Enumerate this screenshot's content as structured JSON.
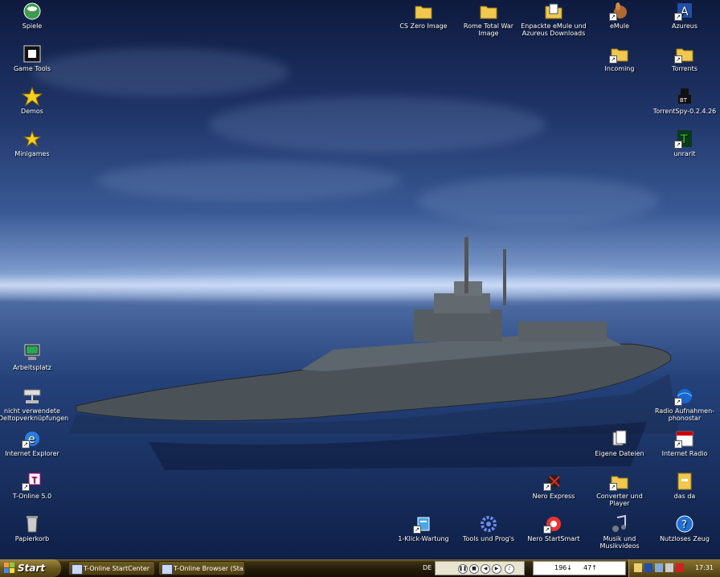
{
  "desktop": {
    "icons_left": [
      {
        "label": "Spiele",
        "icon": "games-icon"
      },
      {
        "label": "Game Tools",
        "icon": "game-tools-icon"
      },
      {
        "label": "Demos",
        "icon": "star-icon"
      },
      {
        "label": "Minigames",
        "icon": "star-icon"
      },
      {
        "label": "Arbeitsplatz",
        "icon": "computer-icon"
      },
      {
        "label": "nicht verwendete Deltopverknüpfungen",
        "icon": "network-icon"
      },
      {
        "label": "Internet Explorer",
        "icon": "ie-icon"
      },
      {
        "label": "T-Online 5.0",
        "icon": "tonline-icon"
      },
      {
        "label": "Papierkorb",
        "icon": "recycle-bin-icon"
      }
    ],
    "icons_top": [
      {
        "label": "CS Zero Image",
        "icon": "folder-icon"
      },
      {
        "label": "Rome Total War Image",
        "icon": "folder-icon"
      },
      {
        "label": "Enpackte eMule und Azureus Downloads",
        "icon": "folder-files-icon"
      },
      {
        "label": "eMule",
        "icon": "emule-icon"
      },
      {
        "label": "Azureus",
        "icon": "azureus-icon"
      },
      {
        "label": "Incoming",
        "icon": "folder-icon"
      },
      {
        "label": "Torrents",
        "icon": "folder-icon"
      },
      {
        "label": "TorrentSpy-0.2.4.26",
        "icon": "torrentspy-icon"
      },
      {
        "label": "unrarit",
        "icon": "unrar-icon"
      }
    ],
    "icons_right": [
      {
        "label": "Radio Aufnahmen-phonostar",
        "icon": "globe-icon"
      },
      {
        "label": "Eigene Dateien",
        "icon": "documents-icon"
      },
      {
        "label": "Internet Radio",
        "icon": "radio-icon"
      },
      {
        "label": "Nero Express",
        "icon": "nero-express-icon"
      },
      {
        "label": "Converter und Player",
        "icon": "folder-icon"
      },
      {
        "label": "das da",
        "icon": "archive-icon"
      },
      {
        "label": "1-Klick-Wartung",
        "icon": "maintenance-icon"
      },
      {
        "label": "Tools und Prog's",
        "icon": "gear-icon"
      },
      {
        "label": "Nero StartSmart",
        "icon": "nero-icon"
      },
      {
        "label": "Musik und Musikvideos",
        "icon": "music-icon"
      },
      {
        "label": "Nutzloses Zeug",
        "icon": "help-icon"
      }
    ]
  },
  "taskbar": {
    "start_label": "Start",
    "tasks": [
      {
        "label": "T-Online StartCenter"
      },
      {
        "label": "T-Online Browser (Sta..."
      }
    ],
    "language": "DE",
    "net_down": "196↓",
    "net_up": "47↑",
    "clock": "17:31"
  },
  "colors": {
    "taskbar": "#2a2208",
    "start": "#6b5a1c",
    "sky": "#1f3468",
    "sea": "#24417a"
  }
}
